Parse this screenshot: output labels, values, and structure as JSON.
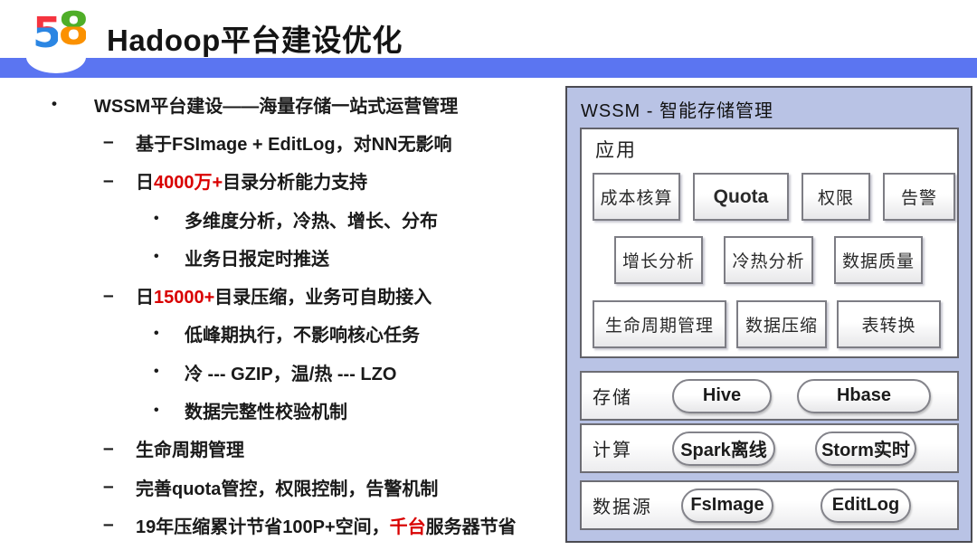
{
  "header": {
    "logo_digit_1": "5",
    "logo_digit_2": "8",
    "title": "Hadoop平台建设优化"
  },
  "colors": {
    "accent_bar": "#5b75f1",
    "red_highlight": "#d90000",
    "panel_background": "#b9c3e5"
  },
  "left": {
    "bullets": [
      {
        "marker": "•",
        "pre": "WSSM平台建设——海量存储一站式运营管理",
        "red": "",
        "post": ""
      },
      {
        "marker": "–",
        "pre": "基于FSImage + EditLog，对NN无影响",
        "red": "",
        "post": ""
      },
      {
        "marker": "–",
        "pre": "日",
        "red": "4000万+",
        "post": "目录分析能力支持"
      },
      {
        "marker": "•",
        "pre": "多维度分析，冷热、增长、分布",
        "red": "",
        "post": ""
      },
      {
        "marker": "•",
        "pre": "业务日报定时推送",
        "red": "",
        "post": ""
      },
      {
        "marker": "–",
        "pre": "日",
        "red": "15000+",
        "post": "目录压缩，业务可自助接入"
      },
      {
        "marker": "•",
        "pre": "低峰期执行，不影响核心任务",
        "red": "",
        "post": ""
      },
      {
        "marker": "•",
        "pre": "冷 --- GZIP，温/热 --- LZO",
        "red": "",
        "post": ""
      },
      {
        "marker": "•",
        "pre": "数据完整性校验机制",
        "red": "",
        "post": ""
      },
      {
        "marker": "–",
        "pre": "生命周期管理",
        "red": "",
        "post": ""
      },
      {
        "marker": "–",
        "pre": "完善quota管控，权限控制，告警机制",
        "red": "",
        "post": ""
      },
      {
        "marker": "–",
        "pre": "19年压缩累计节省100P+空间，",
        "red": "千台",
        "post": "服务器节省"
      }
    ]
  },
  "diagram": {
    "title": "WSSM - 智能存储管理",
    "app": {
      "label": "应用",
      "row1": [
        "成本核算",
        "Quota",
        "权限",
        "告警"
      ],
      "row2": [
        "增长分析",
        "冷热分析",
        "数据质量"
      ],
      "row3": [
        "生命周期管理",
        "数据压缩",
        "表转换"
      ]
    },
    "strips": [
      {
        "label": "存储",
        "items": [
          "Hive",
          "Hbase"
        ]
      },
      {
        "label": "计算",
        "items": [
          "Spark离线",
          "Storm实时"
        ]
      },
      {
        "label": "数据源",
        "items": [
          "FsImage",
          "EditLog"
        ]
      }
    ]
  }
}
